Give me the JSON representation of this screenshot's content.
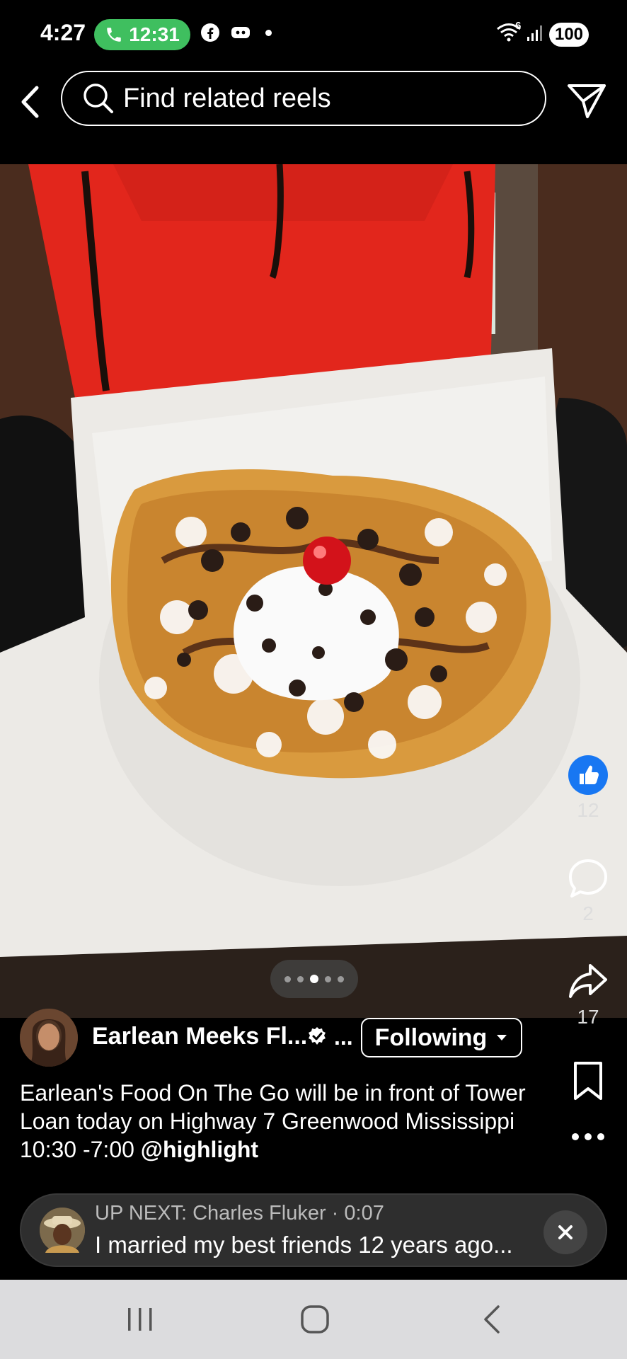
{
  "status_bar": {
    "time": "4:27",
    "call_timer": "12:31",
    "battery": "100",
    "network": "6"
  },
  "search": {
    "placeholder": "Find related reels"
  },
  "reel": {
    "page_indicator": {
      "count": 5,
      "active_index": 2
    },
    "likes": "12",
    "comments": "2",
    "shares": "17",
    "author": {
      "name": "Earlean Meeks Fl...",
      "ellipsis": "...",
      "follow_label": "Following"
    },
    "caption": {
      "text": "Earlean's Food On The Go will be in front of Tower Loan today on Highway 7 Greenwood Mississippi 10:30 -7:00 ",
      "mention": "@highlight"
    }
  },
  "up_next": {
    "prefix": "UP NEXT: ",
    "author": "Charles Fluker",
    "separator": " · ",
    "duration": "0:07",
    "title": "I married my best friends 12 years ago..."
  },
  "colors": {
    "like_blue": "#1877f2",
    "call_green": "#3fbf5f",
    "nav_bar": "#dcdcde"
  }
}
